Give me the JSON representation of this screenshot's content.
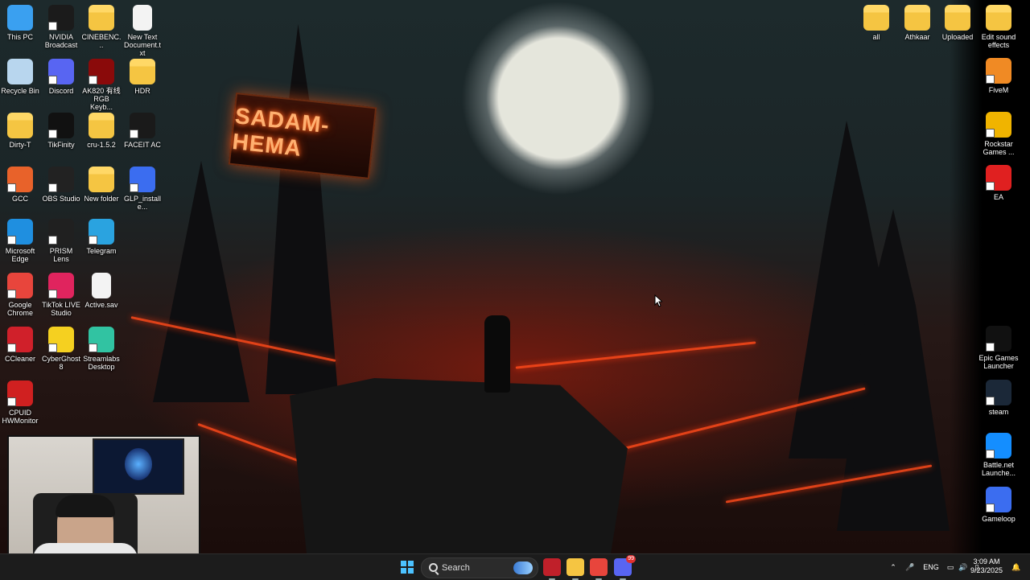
{
  "wallpaper": {
    "sign_text": "SADAM-HEMA"
  },
  "desktop_left": [
    {
      "label": "This PC",
      "icon": "this-pc-icon",
      "color": "#3aa0f0"
    },
    {
      "label": "NVIDIA Broadcast",
      "icon": "nvidia-broadcast-icon",
      "color": "#1b1b1b"
    },
    {
      "label": "CINEBENC...",
      "icon": "folder-icon",
      "color": "#f5c542"
    },
    {
      "label": "New Text Document.txt",
      "icon": "text-document-icon",
      "color": "#f3f3f3"
    },
    {
      "label": "Recycle Bin",
      "icon": "recycle-bin-icon",
      "color": "#b8d6ee"
    },
    {
      "label": "Discord",
      "icon": "discord-icon",
      "color": "#5865f2"
    },
    {
      "label": "AK820 有线 RGB Keyb...",
      "icon": "keyboard-app-icon",
      "color": "#8a0a0a"
    },
    {
      "label": "HDR",
      "icon": "folder-icon",
      "color": "#f5c542"
    },
    {
      "label": "Dirty-T",
      "icon": "folder-icon",
      "color": "#f5c542"
    },
    {
      "label": "TikFinity",
      "icon": "tikfinity-icon",
      "color": "#111111"
    },
    {
      "label": "cru-1.5.2",
      "icon": "folder-icon",
      "color": "#f5c542"
    },
    {
      "label": "FACEIT AC",
      "icon": "faceit-icon",
      "color": "#1a1a1a"
    },
    {
      "label": "GCC",
      "icon": "gcc-icon",
      "color": "#e8622a"
    },
    {
      "label": "OBS Studio",
      "icon": "obs-icon",
      "color": "#222222"
    },
    {
      "label": "New folder",
      "icon": "folder-icon",
      "color": "#f5c542"
    },
    {
      "label": "GLP_installe...",
      "icon": "gameloop-installer-icon",
      "color": "#3b6df0"
    },
    {
      "label": "Microsoft Edge",
      "icon": "edge-icon",
      "color": "#1f8fe0"
    },
    {
      "label": "PRISM Lens",
      "icon": "prism-lens-icon",
      "color": "#202020"
    },
    {
      "label": "Telegram",
      "icon": "telegram-icon",
      "color": "#2aa3e0"
    },
    {
      "label": "Google Chrome",
      "icon": "chrome-icon",
      "color": "#e8453c"
    },
    {
      "label": "TikTok LIVE Studio",
      "icon": "tiktok-live-icon",
      "color": "#e0245e"
    },
    {
      "label": "Active.sav",
      "icon": "file-icon",
      "color": "#f3f3f3"
    },
    {
      "label": "CCleaner",
      "icon": "ccleaner-icon",
      "color": "#d0202a"
    },
    {
      "label": "CyberGhost 8",
      "icon": "cyberghost-icon",
      "color": "#f5d020"
    },
    {
      "label": "Streamlabs Desktop",
      "icon": "streamlabs-icon",
      "color": "#31c3a2"
    },
    {
      "label": "CPUID HWMonitor",
      "icon": "hwmonitor-icon",
      "color": "#d02020"
    }
  ],
  "desktop_right": [
    {
      "label": "all",
      "icon": "folder-icon",
      "color": "#f5c542"
    },
    {
      "label": "Athkaar",
      "icon": "folder-icon",
      "color": "#f5c542"
    },
    {
      "label": "Uploaded",
      "icon": "folder-icon",
      "color": "#f5c542"
    },
    {
      "label": "Edit sound effects",
      "icon": "folder-icon",
      "color": "#f5c542"
    },
    {
      "label": "FiveM",
      "icon": "fivem-icon",
      "color": "#f08a24"
    },
    {
      "label": "Rockstar Games ...",
      "icon": "rockstar-icon",
      "color": "#f0b400"
    },
    {
      "label": "EA",
      "icon": "ea-icon",
      "color": "#e02020"
    },
    {
      "label": "Epic Games Launcher",
      "icon": "epic-games-icon",
      "color": "#111111"
    },
    {
      "label": "steam",
      "icon": "steam-icon",
      "color": "#1b2838"
    },
    {
      "label": "Battle.net Launche...",
      "icon": "battlenet-icon",
      "color": "#148eff"
    },
    {
      "label": "Gameloop",
      "icon": "gameloop-icon",
      "color": "#3b6df0"
    }
  ],
  "taskbar": {
    "search_placeholder": "Search",
    "apps": [
      {
        "name": "streaming-app-icon",
        "color": "#c0202a"
      },
      {
        "name": "file-explorer-icon",
        "color": "#f5c542"
      },
      {
        "name": "chrome-icon",
        "color": "#e8453c"
      },
      {
        "name": "discord-icon",
        "color": "#5865f2"
      }
    ],
    "discord_badge": "99",
    "tray": {
      "language": "ENG",
      "time": "3:09 AM",
      "date": "9/23/2025"
    }
  }
}
